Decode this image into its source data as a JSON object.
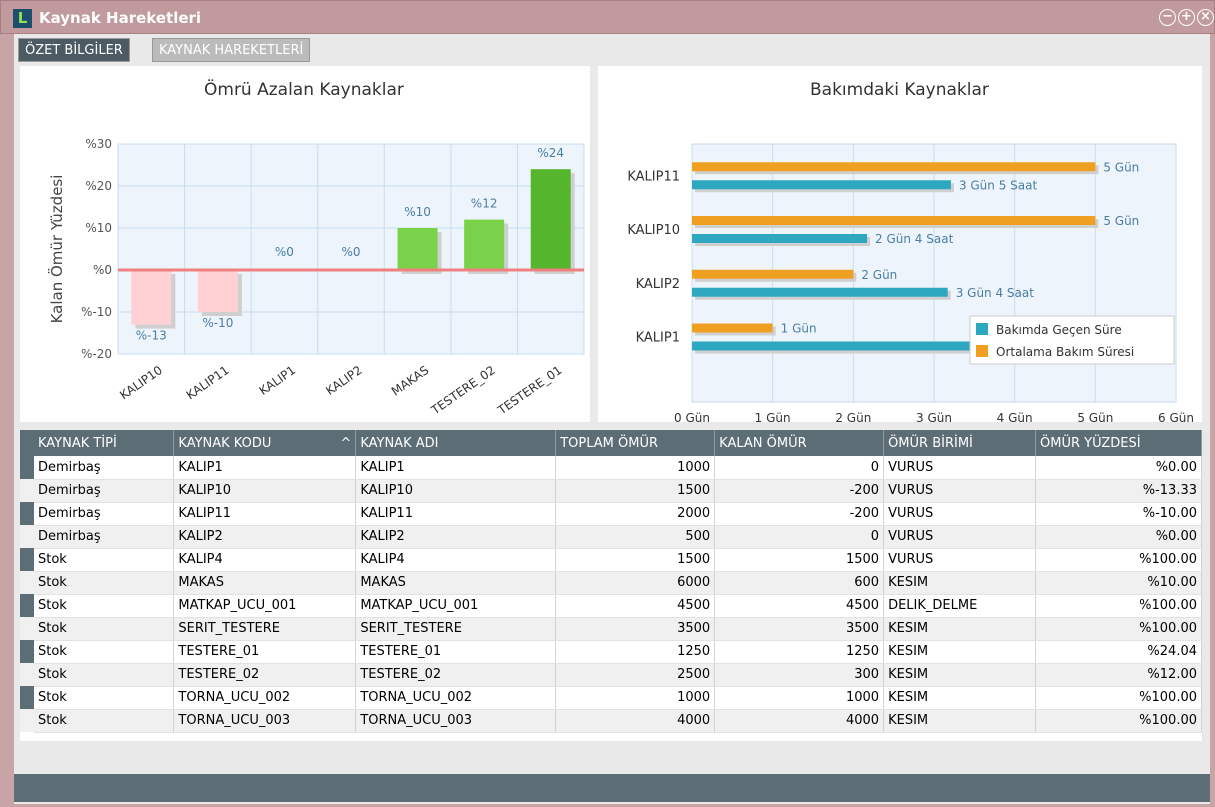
{
  "window": {
    "title": "Kaynak Hareketleri",
    "icon_letter": "L"
  },
  "tabs": [
    {
      "label": "ÖZET BİLGİLER",
      "active": true
    },
    {
      "label": "KAYNAK HAREKETLERİ",
      "active": false
    }
  ],
  "left_chart": {
    "chart_data": {
      "type": "bar",
      "title": "Ömrü Azalan Kaynaklar",
      "xlabel": "",
      "ylabel": "Kalan Ömür Yüzdesi",
      "ylim": [
        -20,
        30
      ],
      "ytick_labels": [
        "%30",
        "%20",
        "%10",
        "%0",
        "%-10",
        "%-20"
      ],
      "categories": [
        "KALIP10",
        "KALIP11",
        "KALIP1",
        "KALIP2",
        "MAKAS",
        "TESTERE_02",
        "TESTERE_01"
      ],
      "values": [
        -13,
        -10,
        0,
        0,
        10,
        12,
        24
      ],
      "value_labels": [
        "%-13",
        "%-10",
        "%0",
        "%0",
        "%10",
        "%12",
        "%24"
      ],
      "grid": true,
      "colors": {
        "negative": "#ffd0d4",
        "positive": "#7ad24a",
        "highlight": "#55b52d",
        "zero_line": "#f08080"
      }
    }
  },
  "right_chart": {
    "chart_data": {
      "type": "bar",
      "orientation": "horizontal",
      "title": "Bakımdaki Kaynaklar",
      "categories": [
        "KALIP11",
        "KALIP10",
        "KALIP2",
        "KALIP1"
      ],
      "xlim": [
        0,
        6
      ],
      "xtick_labels": [
        "0 Gün",
        "1 Gün",
        "2 Gün",
        "3 Gün",
        "4 Gün",
        "5 Gün",
        "6 Gün"
      ],
      "series": [
        {
          "name": "Ortalama Bakım Süresi",
          "color": "#f0a020",
          "values": [
            5,
            5,
            2,
            1
          ],
          "labels": [
            "5 Gün",
            "5 Gün",
            "2 Gün",
            "1 Gün"
          ]
        },
        {
          "name": "Bakımda Geçen Süre",
          "color": "#2ea8c0",
          "values": [
            3.21,
            2.17,
            3.17,
            4.17
          ],
          "labels": [
            "3 Gün 5 Saat",
            "2 Gün 4 Saat",
            "3 Gün 4 Saat",
            "4 Gün 4 Saat"
          ]
        }
      ],
      "legend": {
        "position": "bottom-right",
        "items": [
          "Bakımda Geçen Süre",
          "Ortalama Bakım Süresi"
        ]
      },
      "grid": true
    }
  },
  "table": {
    "columns": [
      "KAYNAK TİPİ",
      "KAYNAK KODU",
      "KAYNAK ADI",
      "TOPLAM ÖMÜR",
      "KALAN ÖMÜR",
      "ÖMÜR BİRİMİ",
      "ÖMÜR YÜZDESİ"
    ],
    "sort_indicator": "^",
    "rows": [
      [
        "Demirbaş",
        "KALIP1",
        "KALIP1",
        "1000",
        "0",
        "VURUS",
        "%0.00"
      ],
      [
        "Demirbaş",
        "KALIP10",
        "KALIP10",
        "1500",
        "-200",
        "VURUS",
        "%-13.33"
      ],
      [
        "Demirbaş",
        "KALIP11",
        "KALIP11",
        "2000",
        "-200",
        "VURUS",
        "%-10.00"
      ],
      [
        "Demirbaş",
        "KALIP2",
        "KALIP2",
        "500",
        "0",
        "VURUS",
        "%0.00"
      ],
      [
        "Stok",
        "KALIP4",
        "KALIP4",
        "1500",
        "1500",
        "VURUS",
        "%100.00"
      ],
      [
        "Stok",
        "MAKAS",
        "MAKAS",
        "6000",
        "600",
        "KESIM",
        "%10.00"
      ],
      [
        "Stok",
        "MATKAP_UCU_001",
        "MATKAP_UCU_001",
        "4500",
        "4500",
        "DELIK_DELME",
        "%100.00"
      ],
      [
        "Stok",
        "SERIT_TESTERE",
        "SERIT_TESTERE",
        "3500",
        "3500",
        "KESIM",
        "%100.00"
      ],
      [
        "Stok",
        "TESTERE_01",
        "TESTERE_01",
        "1250",
        "1250",
        "KESIM",
        "%24.04"
      ],
      [
        "Stok",
        "TESTERE_02",
        "TESTERE_02",
        "2500",
        "300",
        "KESIM",
        "%12.00"
      ],
      [
        "Stok",
        "TORNA_UCU_002",
        "TORNA_UCU_002",
        "1000",
        "1000",
        "KESIM",
        "%100.00"
      ],
      [
        "Stok",
        "TORNA_UCU_003",
        "TORNA_UCU_003",
        "4000",
        "4000",
        "KESIM",
        "%100.00"
      ]
    ]
  }
}
